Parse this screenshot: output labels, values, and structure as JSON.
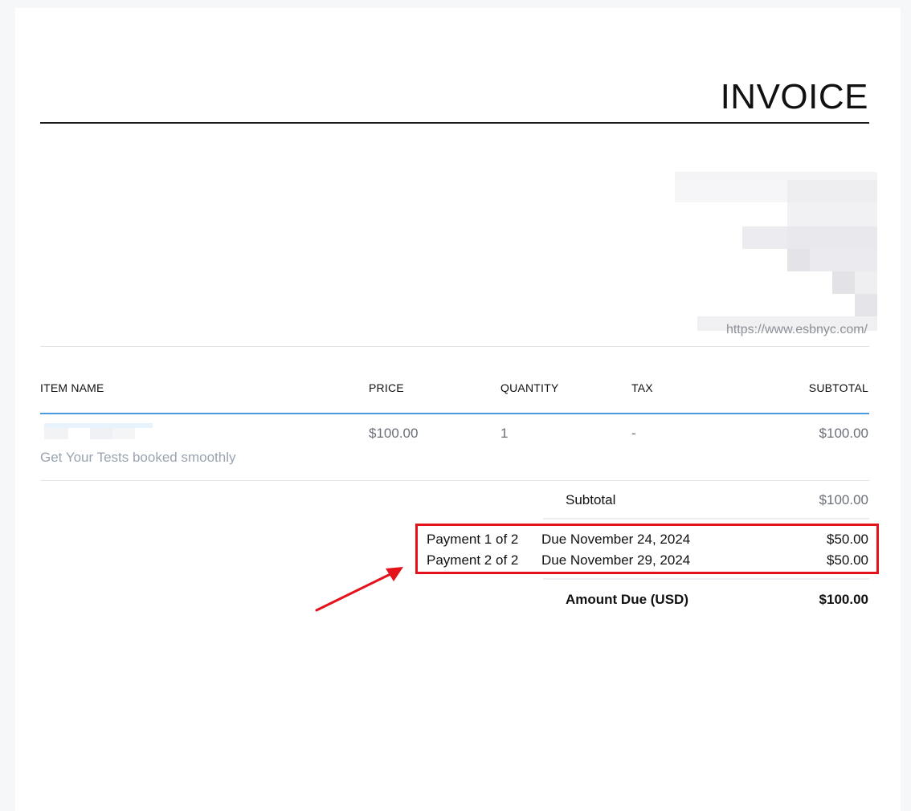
{
  "invoice": {
    "title": "INVOICE",
    "website": "https://www.esbnyc.com/"
  },
  "table": {
    "headers": {
      "item_name": "ITEM NAME",
      "price": "PRICE",
      "quantity": "QUANTITY",
      "tax": "TAX",
      "subtotal": "SUBTOTAL"
    },
    "rows": [
      {
        "description": "Get Your Tests booked smoothly",
        "price": "$100.00",
        "quantity": "1",
        "tax": "-",
        "subtotal": "$100.00"
      }
    ]
  },
  "summary": {
    "subtotal_label": "Subtotal",
    "subtotal_value": "$100.00",
    "payments": [
      {
        "label": "Payment 1 of 2",
        "due": "Due November 24, 2024",
        "amount": "$50.00"
      },
      {
        "label": "Payment 2 of 2",
        "due": "Due November 29, 2024",
        "amount": "$50.00"
      }
    ],
    "amount_due_label": "Amount Due (USD)",
    "amount_due_value": "$100.00"
  },
  "annotation": {
    "highlight_color": "#e3121b"
  }
}
